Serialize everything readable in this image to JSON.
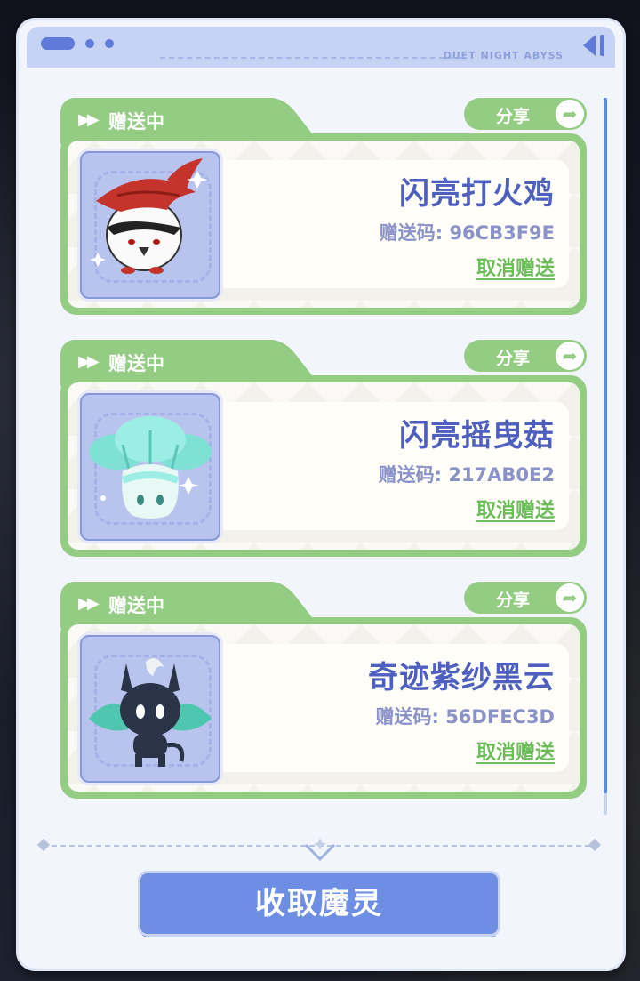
{
  "header": {
    "brand": "DUET NIGHT ABYSS"
  },
  "cards": [
    {
      "status": "赠送中",
      "share_label": "分享",
      "name": "闪亮打火鸡",
      "code": "赠送码: 96CB3F9E",
      "cancel_label": "取消赠送"
    },
    {
      "status": "赠送中",
      "share_label": "分享",
      "name": "闪亮摇曳菇",
      "code": "赠送码: 217AB0E2",
      "cancel_label": "取消赠送"
    },
    {
      "status": "赠送中",
      "share_label": "分享",
      "name": "奇迹紫纱黑云",
      "code": "赠送码: 56DFEC3D",
      "cancel_label": "取消赠送"
    }
  ],
  "footer": {
    "collect_label": "收取魔灵"
  },
  "colors": {
    "accent_green": "#93cc82",
    "accent_blue": "#6e8ee4",
    "name_text": "#4e5fbf"
  }
}
